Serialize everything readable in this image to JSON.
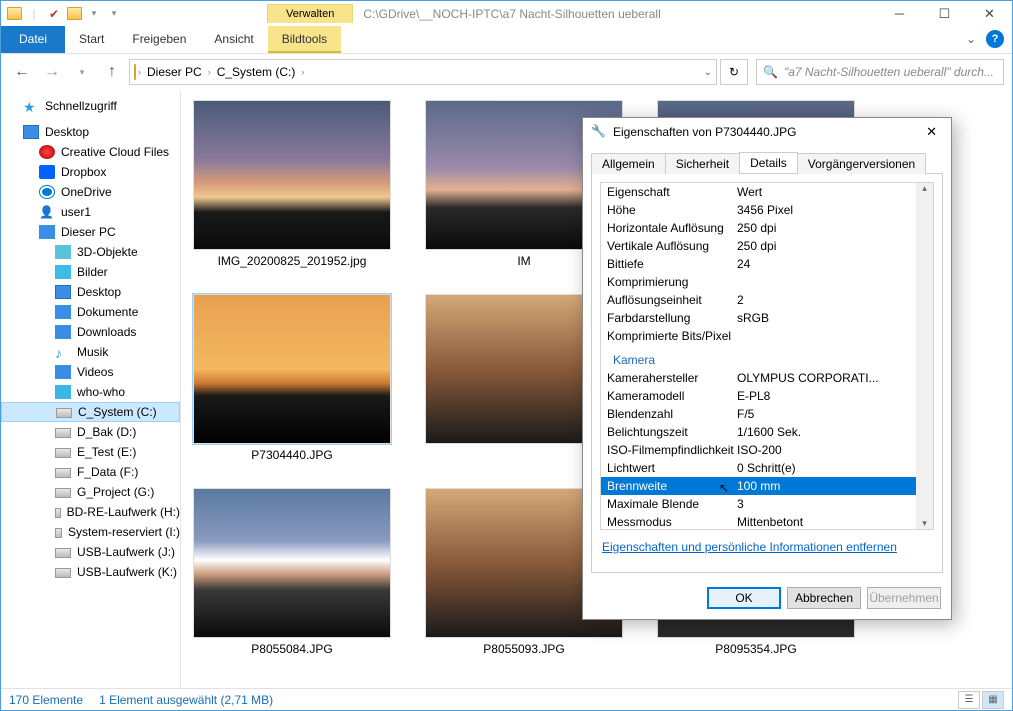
{
  "titlebar": {
    "manage": "Verwalten",
    "path": "C:\\GDrive\\__NOCH-IPTC\\a7 Nacht-Silhouetten ueberall"
  },
  "ribbon": {
    "file": "Datei",
    "start": "Start",
    "share": "Freigeben",
    "view": "Ansicht",
    "tools": "Bildtools"
  },
  "breadcrumb": {
    "pc": "Dieser PC",
    "drive": "C_System (C:)"
  },
  "search": {
    "placeholder": "\"a7 Nacht-Silhouetten ueberall\" durch..."
  },
  "tree": {
    "quick": "Schnellzugriff",
    "desktop": "Desktop",
    "cc": "Creative Cloud Files",
    "dropbox": "Dropbox",
    "onedrive": "OneDrive",
    "user": "user1",
    "thispc": "Dieser PC",
    "obj3d": "3D-Objekte",
    "pictures": "Bilder",
    "desk2": "Desktop",
    "docs": "Dokumente",
    "downloads": "Downloads",
    "music": "Musik",
    "videos": "Videos",
    "who": "who-who",
    "c": "C_System (C:)",
    "d": "D_Bak (D:)",
    "e": "E_Test (E:)",
    "f": "F_Data (F:)",
    "g": "G_Project (G:)",
    "h": "BD-RE-Laufwerk (H:)",
    "i": "System-reserviert (I:)",
    "j": "USB-Laufwerk (J:)",
    "k": "USB-Laufwerk (K:)"
  },
  "thumbs": {
    "t1": "IMG_20200825_201952.jpg",
    "t2": "IM",
    "t3": "P7304440.JPG",
    "t4": "P8055084.JPG",
    "t5": "P8055093.JPG",
    "t6": "P8095354.JPG"
  },
  "status": {
    "count": "170 Elemente",
    "sel": "1 Element ausgewählt (2,71 MB)"
  },
  "dialog": {
    "title": "Eigenschaften von P7304440.JPG",
    "tabs": {
      "general": "Allgemein",
      "security": "Sicherheit",
      "details": "Details",
      "prev": "Vorgängerversionen"
    },
    "hdr_prop": "Eigenschaft",
    "hdr_val": "Wert",
    "rows": {
      "height_k": "Höhe",
      "height_v": "3456 Pixel",
      "hres_k": "Horizontale Auflösung",
      "hres_v": "250 dpi",
      "vres_k": "Vertikale Auflösung",
      "vres_v": "250 dpi",
      "bit_k": "Bittiefe",
      "bit_v": "24",
      "comp_k": "Komprimierung",
      "comp_v": "",
      "resunit_k": "Auflösungseinheit",
      "resunit_v": "2",
      "color_k": "Farbdarstellung",
      "color_v": "sRGB",
      "cbits_k": "Komprimierte Bits/Pixel",
      "cbits_v": "",
      "sec_camera": "Kamera",
      "maker_k": "Kamerahersteller",
      "maker_v": "OLYMPUS CORPORATI...",
      "model_k": "Kameramodell",
      "model_v": "E-PL8",
      "fnum_k": "Blendenzahl",
      "fnum_v": "F/5",
      "exp_k": "Belichtungszeit",
      "exp_v": "1/1600 Sek.",
      "iso_k": "ISO-Filmempfindlichkeit",
      "iso_v": "ISO-200",
      "lv_k": "Lichtwert",
      "lv_v": "0 Schritt(e)",
      "fl_k": "Brennweite",
      "fl_v": "100 mm",
      "maxap_k": "Maximale Blende",
      "maxap_v": "3",
      "meter_k": "Messmodus",
      "meter_v": "Mittenbetont"
    },
    "link": "Eigenschaften und persönliche Informationen entfernen",
    "ok": "OK",
    "cancel": "Abbrechen",
    "apply": "Übernehmen"
  }
}
